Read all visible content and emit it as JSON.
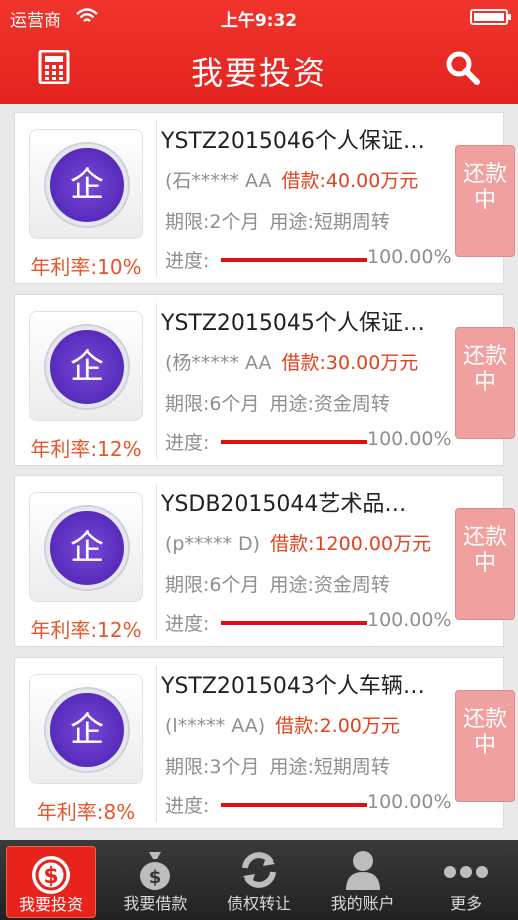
{
  "status_bar": {
    "carrier": "运营商",
    "time": "上午9:32"
  },
  "navbar": {
    "title": "我要投资"
  },
  "loans": [
    {
      "title": "YSTZ2015046个人保证…",
      "borrower": "(石***** AA",
      "amount": "借款:40.00万元",
      "term": "期限:2个月",
      "purpose": "用途:短期周转",
      "progress_label": "进度:",
      "progress_pct": "100.00%",
      "progress_value": 1.0,
      "rate": "年利率:10%",
      "status": "还款中",
      "logo_char": "企"
    },
    {
      "title": "YSTZ2015045个人保证…",
      "borrower": "(杨***** AA",
      "amount": "借款:30.00万元",
      "term": "期限:6个月",
      "purpose": "用途:资金周转",
      "progress_label": "进度:",
      "progress_pct": "100.00%",
      "progress_value": 1.0,
      "rate": "年利率:12%",
      "status": "还款中",
      "logo_char": "企"
    },
    {
      "title": "YSDB2015044艺术品…",
      "borrower": "(p***** D)",
      "amount": "借款:1200.00万元",
      "term": "期限:6个月",
      "purpose": "用途:资金周转",
      "progress_label": "进度:",
      "progress_pct": "100.00%",
      "progress_value": 1.0,
      "rate": "年利率:12%",
      "status": "还款中",
      "logo_char": "企"
    },
    {
      "title": "YSTZ2015043个人车辆…",
      "borrower": "(l***** AA)",
      "amount": "借款:2.00万元",
      "term": "期限:3个月",
      "purpose": "用途:短期周转",
      "progress_label": "进度:",
      "progress_pct": "100.00%",
      "progress_value": 1.0,
      "rate": "年利率:8%",
      "status": "还款中",
      "logo_char": "企"
    }
  ],
  "tabs": [
    {
      "label": "我要投资",
      "icon": "dollar-coin-icon",
      "active": true
    },
    {
      "label": "我要借款",
      "icon": "money-bag-icon",
      "active": false
    },
    {
      "label": "债权转让",
      "icon": "refresh-arrows-icon",
      "active": false
    },
    {
      "label": "我的账户",
      "icon": "user-icon",
      "active": false
    },
    {
      "label": "更多",
      "icon": "more-dots-icon",
      "active": false
    }
  ],
  "colors": {
    "brand_red": "#e4231f",
    "amount_text": "#e2421e",
    "rate_text": "#e8552a",
    "status_tag": "#f1a0a0",
    "progress_fill": "#e01010"
  }
}
